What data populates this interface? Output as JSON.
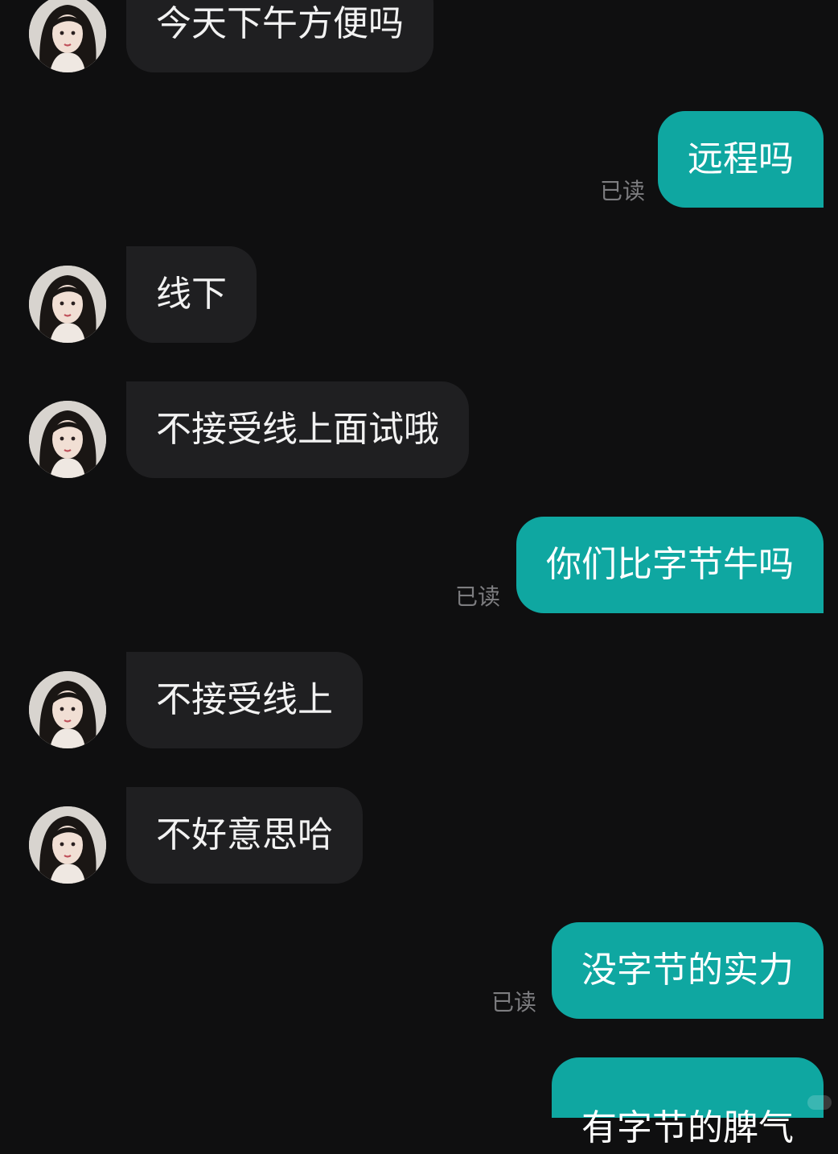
{
  "colors": {
    "background": "#0f0f10",
    "incoming_bubble": "#1f1f21",
    "outgoing_bubble": "#0fa7a1",
    "read_receipt": "#7d7d80"
  },
  "contact": {
    "avatar_icon": "contact-avatar-icon"
  },
  "messages": [
    {
      "from": "contact",
      "text": "今天下午方便吗"
    },
    {
      "from": "me",
      "text": "远程吗",
      "status": "已读"
    },
    {
      "from": "contact",
      "text": "线下"
    },
    {
      "from": "contact",
      "text": "不接受线上面试哦"
    },
    {
      "from": "me",
      "text": "你们比字节牛吗",
      "status": "已读"
    },
    {
      "from": "contact",
      "text": "不接受线上"
    },
    {
      "from": "contact",
      "text": "不好意思哈"
    },
    {
      "from": "me",
      "text": "没字节的实力",
      "status": "已读"
    },
    {
      "from": "me",
      "text": "有字节的脾气"
    }
  ]
}
